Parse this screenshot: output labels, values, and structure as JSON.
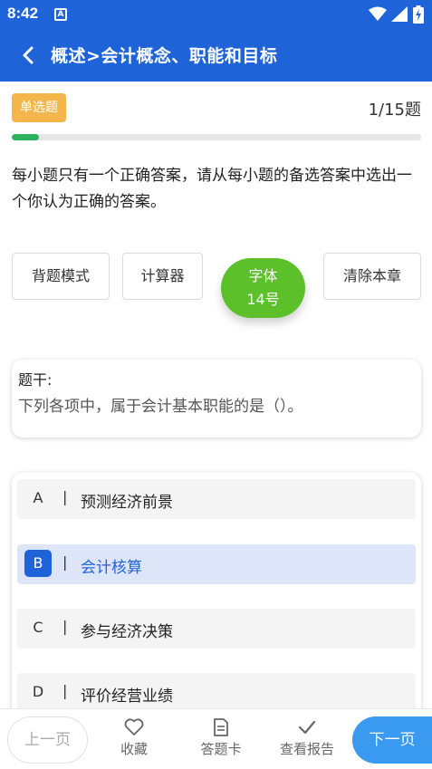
{
  "status_bar": {
    "time": "8:42",
    "notification_icon": "A"
  },
  "app_bar": {
    "back_icon": "chevron-left-icon",
    "title": "概述>会计概念、职能和目标"
  },
  "question": {
    "type_badge": "单选题",
    "progress_text": "1/15题",
    "progress_fraction": 0.067,
    "instruction": "每小题只有一个正确答案，请从每小题的备选答案中选出一个你认为正确的答案。"
  },
  "tools": {
    "recite_mode": "背题模式",
    "calculator": "计算器",
    "font_label": "字体",
    "font_size": "14号",
    "clear_chapter": "清除本章"
  },
  "stem": {
    "label": "题干:",
    "text": "下列各项中，属于会计基本职能的是（）。"
  },
  "options": [
    {
      "letter": "A",
      "separator": "|",
      "text": "预测经济前景",
      "selected": false
    },
    {
      "letter": "B",
      "separator": "|",
      "text": "会计核算",
      "selected": true
    },
    {
      "letter": "C",
      "separator": "|",
      "text": "参与经济决策",
      "selected": false
    },
    {
      "letter": "D",
      "separator": "|",
      "text": "评价经营业绩",
      "selected": false
    }
  ],
  "bottom_bar": {
    "prev": "上一页",
    "favorite": "收藏",
    "answer_card": "答题卡",
    "view_report": "查看报告",
    "next": "下一页"
  },
  "colors": {
    "primary": "#1f63d8",
    "badge": "#f4b64a",
    "progress": "#2eb15f",
    "font_button": "#5cc02a",
    "next_button": "#3a9af0"
  }
}
